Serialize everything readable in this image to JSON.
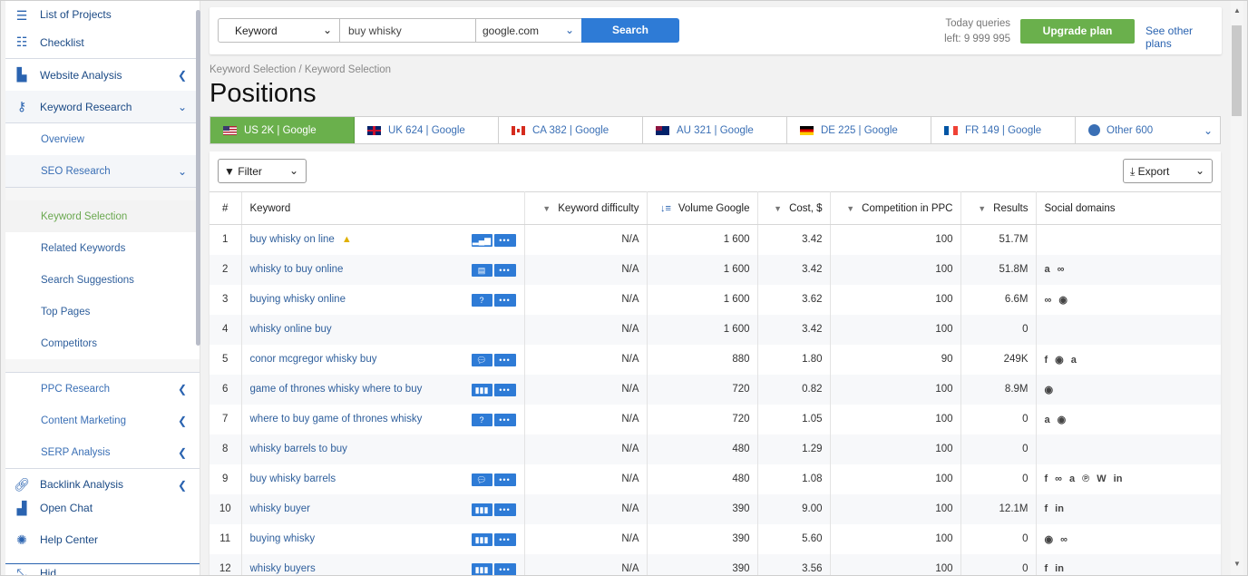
{
  "sidebar": {
    "items": [
      {
        "label": "List of Projects",
        "icon": "menu-icon"
      },
      {
        "label": "Checklist",
        "icon": "list-icon"
      },
      {
        "label": "Website Analysis",
        "icon": "chart-icon"
      },
      {
        "label": "Keyword Research",
        "icon": "key-icon"
      },
      {
        "label": "Overview"
      },
      {
        "label": "SEO Research"
      },
      {
        "label": "Keyword Selection"
      },
      {
        "label": "Related Keywords"
      },
      {
        "label": "Search Suggestions"
      },
      {
        "label": "Top Pages"
      },
      {
        "label": "Competitors"
      },
      {
        "label": "PPC Research"
      },
      {
        "label": "Content Marketing"
      },
      {
        "label": "SERP Analysis"
      },
      {
        "label": "Backlink Analysis",
        "icon": "link-icon"
      },
      {
        "label": "Open Chat",
        "icon": "chat-icon"
      },
      {
        "label": "Help Center",
        "icon": "bulb-icon"
      },
      {
        "label": "Hid..."
      }
    ]
  },
  "search": {
    "type_label": "Keyword",
    "query": "buy whisky",
    "database": "google.com",
    "button": "Search"
  },
  "account": {
    "queries_line1": "Today queries",
    "queries_line2": "left: 9 999 995",
    "upgrade": "Upgrade plan",
    "other_plans": "See other plans"
  },
  "breadcrumb": "Keyword Selection / Keyword Selection",
  "page_title": "Positions",
  "regions": [
    {
      "label": "US 2K | Google",
      "flag": "us",
      "active": true
    },
    {
      "label": "UK 624 | Google",
      "flag": "uk"
    },
    {
      "label": "CA 382 | Google",
      "flag": "ca"
    },
    {
      "label": "AU 321 | Google",
      "flag": "au"
    },
    {
      "label": "DE 225 | Google",
      "flag": "de"
    },
    {
      "label": "FR 149 | Google",
      "flag": "fr"
    },
    {
      "label": "Other 600",
      "flag": "globe"
    }
  ],
  "toolbar": {
    "filter": "Filter",
    "export": "Export"
  },
  "table": {
    "headers": {
      "n": "#",
      "keyword": "Keyword",
      "difficulty": "Keyword difficulty",
      "volume": "Volume Google",
      "cost": "Cost, $",
      "competition": "Competition in PPC",
      "results": "Results",
      "social": "Social domains"
    },
    "rows": [
      {
        "n": "1",
        "kw": "buy whisky on line",
        "warn": true,
        "serp": "bars",
        "diff": "N/A",
        "vol": "1 600",
        "cost": "3.42",
        "comp": "100",
        "res": "51.7M",
        "soc": []
      },
      {
        "n": "2",
        "kw": "whisky to buy online",
        "serp": "card",
        "diff": "N/A",
        "vol": "1 600",
        "cost": "3.42",
        "comp": "100",
        "res": "51.8M",
        "soc": [
          "a",
          "∞"
        ]
      },
      {
        "n": "3",
        "kw": "buying whisky online",
        "serp": "q",
        "diff": "N/A",
        "vol": "1 600",
        "cost": "3.62",
        "comp": "100",
        "res": "6.6M",
        "soc": [
          "∞",
          "◉"
        ]
      },
      {
        "n": "4",
        "kw": "whisky online buy",
        "serp": "",
        "diff": "N/A",
        "vol": "1 600",
        "cost": "3.42",
        "comp": "100",
        "res": "0",
        "soc": []
      },
      {
        "n": "5",
        "kw": "conor mcgregor whisky buy",
        "serp": "chat",
        "diff": "N/A",
        "vol": "880",
        "cost": "1.80",
        "comp": "90",
        "res": "249K",
        "soc": [
          "f",
          "◉",
          "a"
        ]
      },
      {
        "n": "6",
        "kw": "game of thrones whisky where to buy",
        "serp": "grid",
        "diff": "N/A",
        "vol": "720",
        "cost": "0.82",
        "comp": "100",
        "res": "8.9M",
        "soc": [
          "◉"
        ]
      },
      {
        "n": "7",
        "kw": "where to buy game of thrones whisky",
        "serp": "q",
        "diff": "N/A",
        "vol": "720",
        "cost": "1.05",
        "comp": "100",
        "res": "0",
        "soc": [
          "a",
          "◉"
        ]
      },
      {
        "n": "8",
        "kw": "whisky barrels to buy",
        "serp": "",
        "diff": "N/A",
        "vol": "480",
        "cost": "1.29",
        "comp": "100",
        "res": "0",
        "soc": []
      },
      {
        "n": "9",
        "kw": "buy whisky barrels",
        "serp": "chat",
        "diff": "N/A",
        "vol": "480",
        "cost": "1.08",
        "comp": "100",
        "res": "0",
        "soc": [
          "f",
          "∞",
          "a",
          "℗",
          "W",
          "in"
        ]
      },
      {
        "n": "10",
        "kw": "whisky buyer",
        "serp": "grid",
        "diff": "N/A",
        "vol": "390",
        "cost": "9.00",
        "comp": "100",
        "res": "12.1M",
        "soc": [
          "f",
          "in"
        ]
      },
      {
        "n": "11",
        "kw": "buying whisky",
        "serp": "grid",
        "diff": "N/A",
        "vol": "390",
        "cost": "5.60",
        "comp": "100",
        "res": "0",
        "soc": [
          "◉",
          "∞"
        ]
      },
      {
        "n": "12",
        "kw": "whisky buyers",
        "serp": "grid",
        "diff": "N/A",
        "vol": "390",
        "cost": "3.56",
        "comp": "100",
        "res": "0",
        "soc": [
          "f",
          "in"
        ]
      }
    ]
  }
}
